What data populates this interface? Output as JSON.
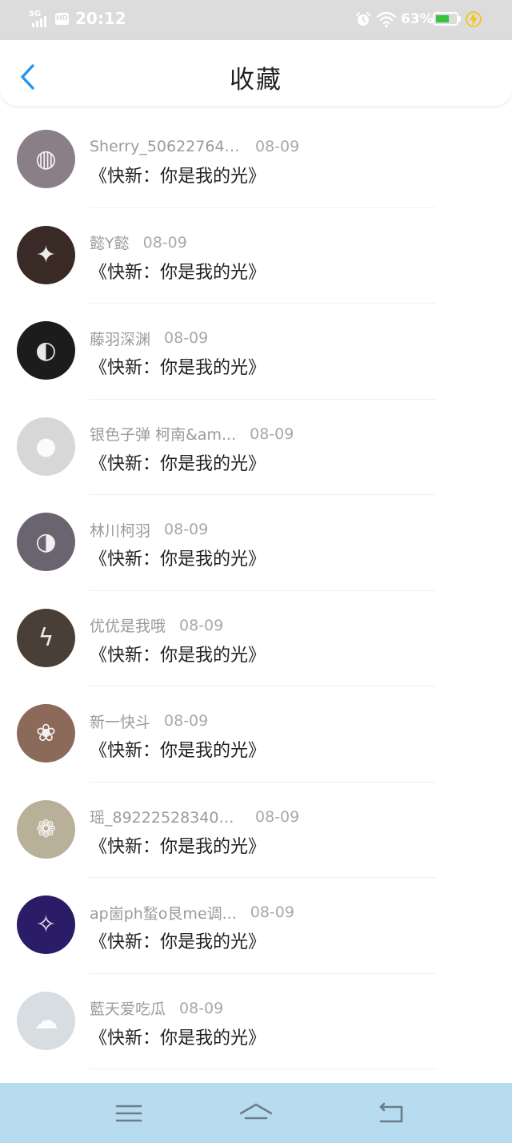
{
  "status_bar": {
    "network": "5G",
    "hd": "HD",
    "time": "20:12",
    "battery_percent": "63%",
    "battery_level": 0.63,
    "battery_color": "#39c23e",
    "icons": [
      "signal-icon",
      "hd-icon",
      "alarm-icon",
      "wifi-icon",
      "battery-icon",
      "charging-icon"
    ]
  },
  "header": {
    "title": "收藏",
    "back_icon": "chevron-left-icon",
    "accent": "#2196f3"
  },
  "items": [
    {
      "name": "Sherry_506227648...",
      "date": "08-09",
      "book": "《快新：你是我的光》",
      "avatar_color": "#8a7f86",
      "avatar_glyph": "◍"
    },
    {
      "name": "懿Y懿",
      "date": "08-09",
      "book": "《快新：你是我的光》",
      "avatar_color": "#3a2a25",
      "avatar_glyph": "✦"
    },
    {
      "name": "藤羽深渊",
      "date": "08-09",
      "book": "《快新：你是我的光》",
      "avatar_color": "#1c1c1c",
      "avatar_glyph": "◐"
    },
    {
      "name": "银色子弹 柯南&am...",
      "date": "08-09",
      "book": "《快新：你是我的光》",
      "avatar_color": "#d7d7d7",
      "avatar_glyph": "●"
    },
    {
      "name": "林川柯羽",
      "date": "08-09",
      "book": "《快新：你是我的光》",
      "avatar_color": "#6a6470",
      "avatar_glyph": "◑"
    },
    {
      "name": "优优是我哦",
      "date": "08-09",
      "book": "《快新：你是我的光》",
      "avatar_color": "#4a3f36",
      "avatar_glyph": "ϟ"
    },
    {
      "name": "新一快斗",
      "date": "08-09",
      "book": "《快新：你是我的光》",
      "avatar_color": "#8b6a5a",
      "avatar_glyph": "❀"
    },
    {
      "name": "瑶_892225283408...",
      "date": "08-09",
      "book": "《快新：你是我的光》",
      "avatar_color": "#b9b09a",
      "avatar_glyph": "❁"
    },
    {
      "name": "ap崮ph蝵o艮me调...",
      "date": "08-09",
      "book": "《快新：你是我的光》",
      "avatar_color": "#2a1c66",
      "avatar_glyph": "✧"
    },
    {
      "name": "藍天爱吃瓜",
      "date": "08-09",
      "book": "《快新：你是我的光》",
      "avatar_color": "#d8dde2",
      "avatar_glyph": "☁"
    }
  ],
  "system_nav": {
    "background": "#b7dcf0",
    "icons": [
      "menu-icon",
      "home-icon",
      "back-icon"
    ]
  }
}
